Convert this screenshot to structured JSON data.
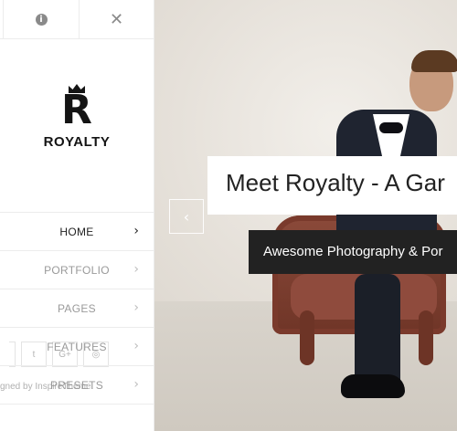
{
  "toolbar": {
    "info_icon": "info-icon",
    "close_icon": "close-icon"
  },
  "logo": {
    "letter": "R",
    "name": "ROYALTY"
  },
  "menu": {
    "items": [
      {
        "label": "HOME",
        "active": true
      },
      {
        "label": "PORTFOLIO",
        "active": false
      },
      {
        "label": "PAGES",
        "active": false
      },
      {
        "label": "FEATURES",
        "active": false
      },
      {
        "label": "PRESETS",
        "active": false
      }
    ]
  },
  "footer": {
    "credit": "gned by InspireTheme."
  },
  "slider": {
    "headline": "Meet Royalty - A Gar",
    "subline": "Awesome Photography & Por",
    "prev_icon": "chevron-left-icon"
  },
  "colors": {
    "accent": "#222222",
    "headline_bg": "#ffffff",
    "chair": "#8b4a3a"
  }
}
